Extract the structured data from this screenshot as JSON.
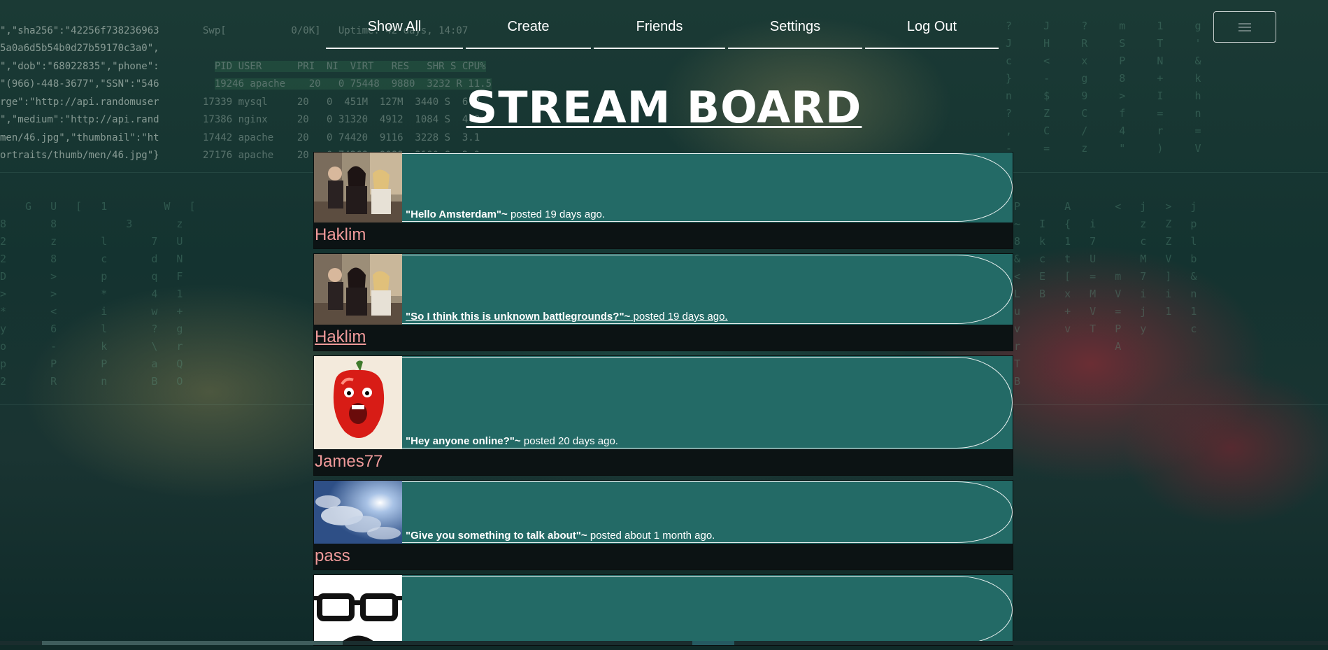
{
  "nav": {
    "items": [
      {
        "label": "Show All"
      },
      {
        "label": "Create"
      },
      {
        "label": "Friends"
      },
      {
        "label": "Settings"
      },
      {
        "label": "Log Out"
      }
    ]
  },
  "page_title": "STREAM BOARD",
  "posts": [
    {
      "message": "\"Hello Amsterdam\"~",
      "meta": " posted 19 days ago.",
      "author": "Haklim",
      "avatar": "group-photo"
    },
    {
      "message": "\"So I think this is unknown battlegrounds?\"~",
      "meta": " posted 19 days ago.",
      "author": "Haklim",
      "avatar": "group-photo"
    },
    {
      "message": "\"Hey anyone online?\"~",
      "meta": " posted 20 days ago.",
      "author": "James77",
      "avatar": "pepper-face"
    },
    {
      "message": "\"Give you something to talk about\"~",
      "meta": " posted about 1 month ago.",
      "author": "pass",
      "avatar": "sky-clouds"
    },
    {
      "message": "",
      "meta": "",
      "author": "",
      "avatar": "glasses-mustache"
    }
  ]
}
